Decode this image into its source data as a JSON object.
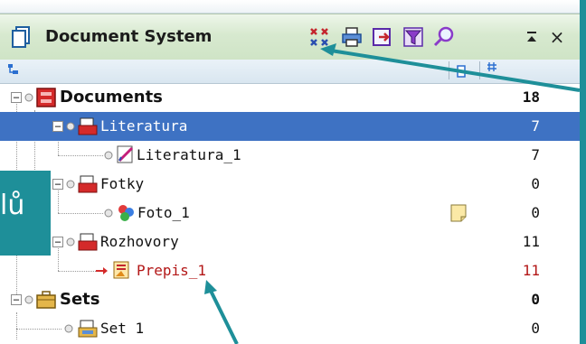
{
  "window": {
    "title": "Document System",
    "buttons": [
      "collapse-expand-icon",
      "print-icon",
      "export-icon",
      "filter-icon",
      "search-icon"
    ],
    "minimize_glyph": "⌅",
    "close_glyph": "×"
  },
  "columns": {
    "tree_icon": "tree-icon",
    "note_icon": "note-column-icon",
    "count_icon": "count-column-icon"
  },
  "tree": [
    {
      "label": "Documents",
      "count": "18",
      "bold": true,
      "level": 0
    },
    {
      "label": "Literatura",
      "count": "7",
      "level": 1,
      "selected": true
    },
    {
      "label": "Literatura_1",
      "count": "7",
      "level": 2
    },
    {
      "label": "Fotky",
      "count": "0",
      "level": 1
    },
    {
      "label": "Foto_1",
      "count": "0",
      "level": 2,
      "has_note": true
    },
    {
      "label": "Rozhovory",
      "count": "11",
      "level": 1
    },
    {
      "label": "Prepis_1",
      "count": "11",
      "level": 2,
      "red": true
    },
    {
      "label": "Sets",
      "count": "0",
      "bold": true,
      "level": 0
    },
    {
      "label": "Set 1",
      "count": "0",
      "level": 1
    }
  ],
  "callout": {
    "text": "lů"
  },
  "colors": {
    "callout_teal": "#1e8f99",
    "selection_blue": "#3e72c3",
    "title_green": "#d7e9cf",
    "prepis_red": "#b31717"
  }
}
